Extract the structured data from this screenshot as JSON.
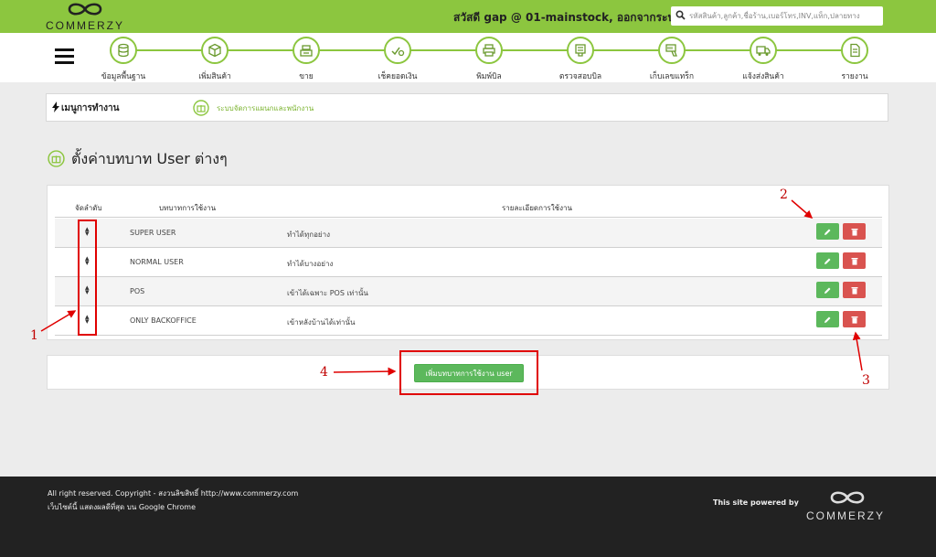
{
  "brand": {
    "name": "COMMERZY"
  },
  "header": {
    "greeting": "สวัสดี gap @ 01-mainstock,",
    "logout": "ออกจากระบบ",
    "search_placeholder": "รหัสสินค้า,ลูกค้า,ชื่อร้าน,เบอร์โทร,INV,แท็ก,ปลายทาง"
  },
  "nav": {
    "items": [
      {
        "label": "ข้อมูลพื้นฐาน",
        "icon": "database-icon"
      },
      {
        "label": "เพิ่มสินค้า",
        "icon": "box-icon"
      },
      {
        "label": "ขาย",
        "icon": "cash-register-icon"
      },
      {
        "label": "เช็คยอดเงิน",
        "icon": "money-check-icon"
      },
      {
        "label": "พิมพ์บิล",
        "icon": "printer-icon"
      },
      {
        "label": "ตรวจสอบบิล",
        "icon": "scan-bill-icon"
      },
      {
        "label": "เก็บเลขแทร็ก",
        "icon": "barcode-scanner-icon"
      },
      {
        "label": "แจ้งส่งสินค้า",
        "icon": "truck-icon"
      },
      {
        "label": "รายงาน",
        "icon": "report-icon"
      }
    ]
  },
  "breadcrumb": {
    "title": "เมนูการทำงาน",
    "sub": "ระบบจัดการแผนกและพนักงาน"
  },
  "page": {
    "title": "ตั้งค่าบทบาท User ต่างๆ"
  },
  "table": {
    "headers": {
      "order": "จัดลำดับ",
      "role": "บทบาทการใช้งาน",
      "detail": "รายละเอียดการใช้งาน"
    },
    "rows": [
      {
        "role": "SUPER USER",
        "detail": "ทำได้ทุกอย่าง"
      },
      {
        "role": "NORMAL USER",
        "detail": "ทำได้บางอย่าง"
      },
      {
        "role": "POS",
        "detail": "เข้าได้เฉพาะ POS เท่านั้น"
      },
      {
        "role": "ONLY BACKOFFICE",
        "detail": "เข้าหลังบ้านได้เท่านั้น"
      }
    ]
  },
  "add_button": {
    "label": "เพิ่มบทบาทการใช้งาน user"
  },
  "annotations": [
    "1",
    "2",
    "3",
    "4"
  ],
  "footer": {
    "copyright": "All right reserved. Copyright - สงวนลิขสิทธิ์ http://www.commerzy.com",
    "browser_note": "เว็บไซต์นี้ แสดงผลดีที่สุด บน Google Chrome",
    "powered_by": "This site powered by",
    "brand": "COMMERZY"
  },
  "colors": {
    "brand_green": "#8cc63f",
    "edit_green": "#5cb85c",
    "delete_red": "#d9534f",
    "annotation_red": "#e00000",
    "footer_bg": "#222222"
  }
}
